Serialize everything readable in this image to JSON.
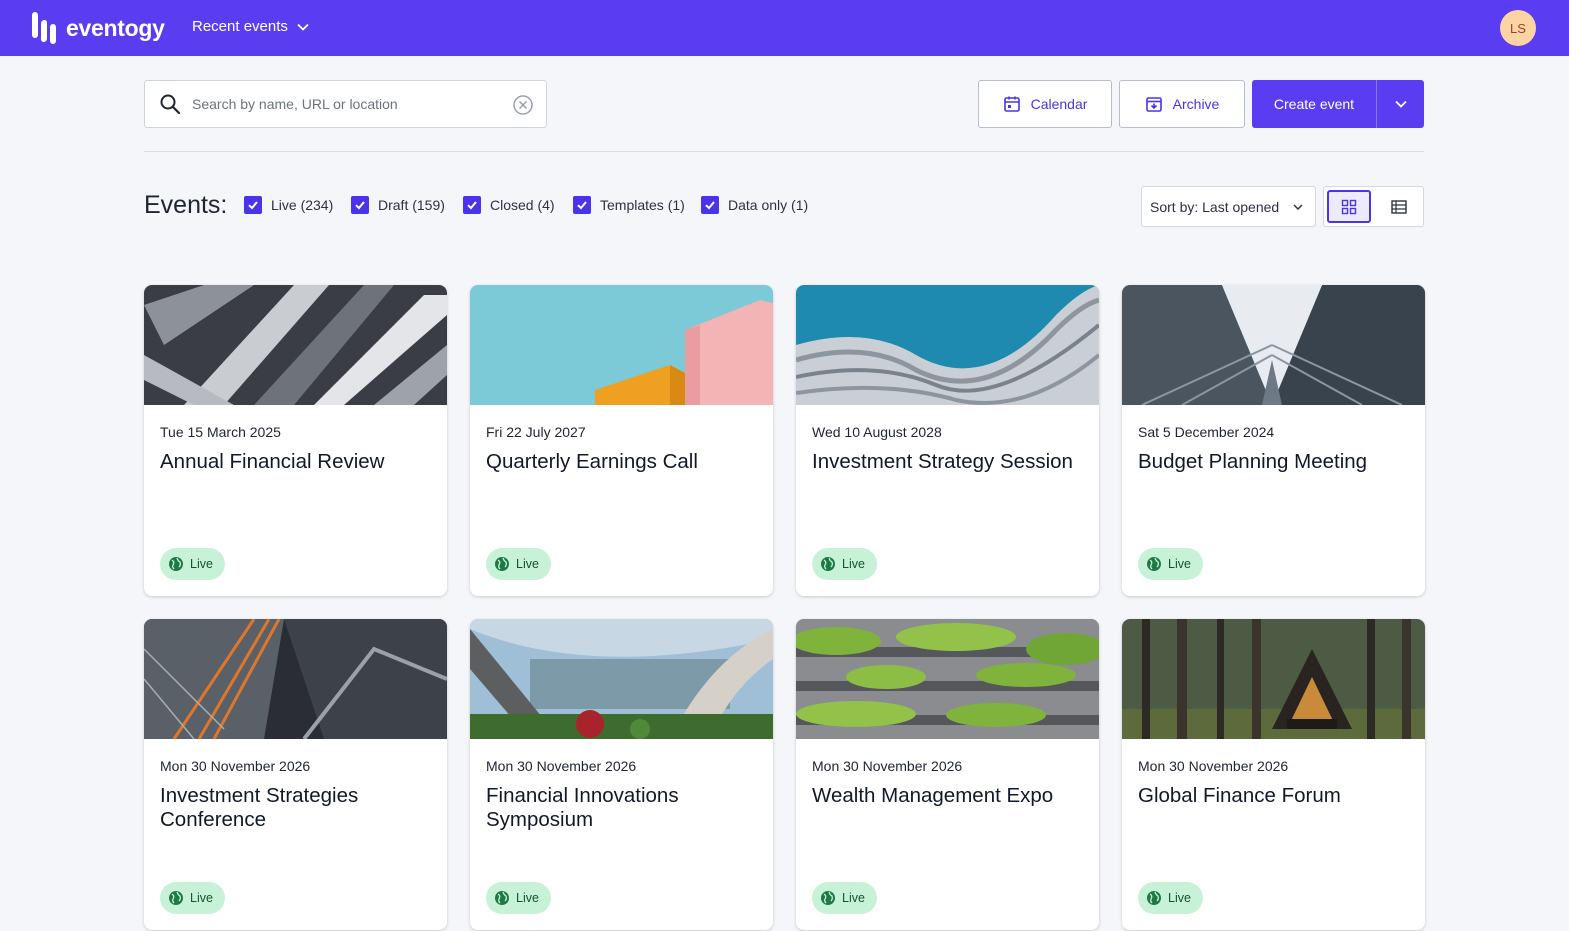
{
  "header": {
    "brand": "eventogy",
    "recent_label": "Recent events",
    "avatar_initials": "LS",
    "brand_color": "#5a3df0"
  },
  "toolbar": {
    "search_placeholder": "Search by name, URL or location",
    "search_value": "",
    "calendar_label": "Calendar",
    "archive_label": "Archive",
    "create_label": "Create event"
  },
  "filters": {
    "heading": "Events:",
    "items": [
      {
        "label": "Live (234)",
        "checked": true
      },
      {
        "label": "Draft (159)",
        "checked": true
      },
      {
        "label": "Closed (4)",
        "checked": true
      },
      {
        "label": "Templates (1)",
        "checked": true
      },
      {
        "label": "Data only (1)",
        "checked": true
      }
    ],
    "sort_label": "Sort by: Last opened",
    "view_mode": "grid"
  },
  "events": [
    {
      "date": "Tue 15 March 2025",
      "title": "Annual Financial Review",
      "status": "Live",
      "image": "building-slats"
    },
    {
      "date": "Fri 22 July 2027",
      "title": "Quarterly Earnings Call",
      "status": "Live",
      "image": "pastel-blocks"
    },
    {
      "date": "Wed 10 August 2028",
      "title": "Investment Strategy Session",
      "status": "Live",
      "image": "wave-facade"
    },
    {
      "date": "Sat 5 December 2024",
      "title": "Budget Planning Meeting",
      "status": "Live",
      "image": "glass-towers"
    },
    {
      "date": "Mon 30 November 2026",
      "title": "Investment Strategies Conference",
      "status": "Live",
      "image": "skyscraper-orange"
    },
    {
      "date": "Mon 30 November 2026",
      "title": "Financial Innovations Symposium",
      "status": "Live",
      "image": "curved-roof"
    },
    {
      "date": "Mon 30 November 2026",
      "title": "Wealth Management Expo",
      "status": "Live",
      "image": "green-building"
    },
    {
      "date": "Mon 30 November 2026",
      "title": "Global Finance Forum",
      "status": "Live",
      "image": "forest-cabin"
    }
  ]
}
